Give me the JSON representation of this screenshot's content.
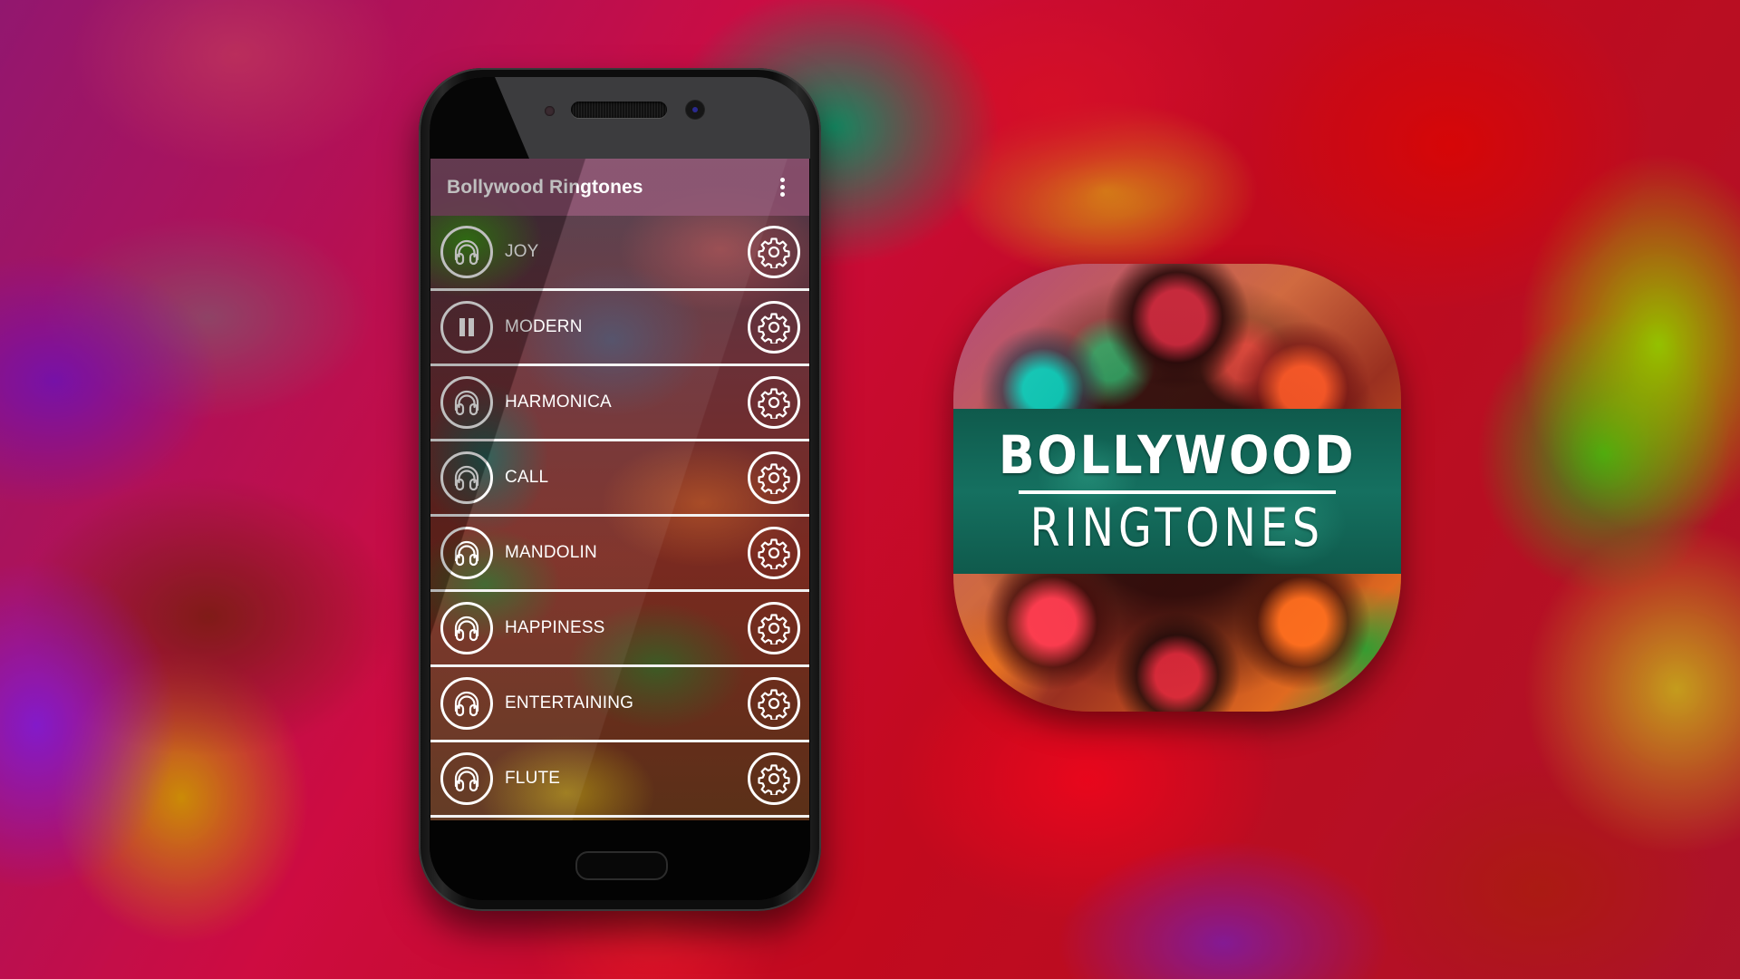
{
  "app": {
    "title": "Bollywood Ringtones"
  },
  "toolbar": {
    "overflow_menu_icon": "more-vert-icon"
  },
  "ringtones": [
    {
      "label": "JOY",
      "state": "stopped",
      "play_icon": "headphones-icon",
      "settings_icon": "gear-icon"
    },
    {
      "label": "MODERN",
      "state": "playing",
      "play_icon": "pause-icon",
      "settings_icon": "gear-icon"
    },
    {
      "label": "HARMONICA",
      "state": "stopped",
      "play_icon": "headphones-icon",
      "settings_icon": "gear-icon"
    },
    {
      "label": "CALL",
      "state": "stopped",
      "play_icon": "headphones-icon",
      "settings_icon": "gear-icon"
    },
    {
      "label": "MANDOLIN",
      "state": "stopped",
      "play_icon": "headphones-icon",
      "settings_icon": "gear-icon"
    },
    {
      "label": "HAPPINESS",
      "state": "stopped",
      "play_icon": "headphones-icon",
      "settings_icon": "gear-icon"
    },
    {
      "label": "ENTERTAINING",
      "state": "stopped",
      "play_icon": "headphones-icon",
      "settings_icon": "gear-icon"
    },
    {
      "label": "FLUTE",
      "state": "stopped",
      "play_icon": "headphones-icon",
      "settings_icon": "gear-icon"
    }
  ],
  "promo_icon": {
    "line1": "BOLLYWOOD",
    "line2": "RINGTONES",
    "band_color": "#157060"
  },
  "colors": {
    "appbar": "#8c506e",
    "divider": "#f2f2f2",
    "text": "#ffffff"
  }
}
